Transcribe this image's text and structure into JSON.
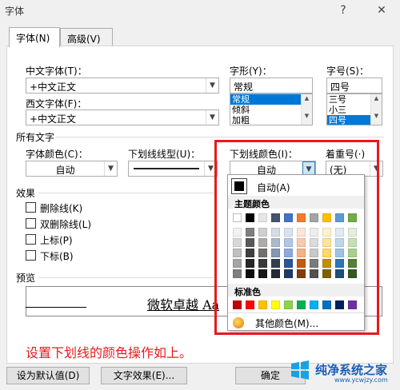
{
  "window": {
    "title": "字体",
    "help": "?",
    "close": "✕"
  },
  "tabs": [
    {
      "label": "字体(N)"
    },
    {
      "label": "高级(V)"
    }
  ],
  "font": {
    "chinese_label": "中文字体(T)：",
    "chinese_value": "+中文正文",
    "western_label": "西文字体(F)：",
    "western_value": "+中文正文",
    "style_label": "字形(Y)：",
    "style_value": "常规",
    "style_options": [
      "常规",
      "倾斜",
      "加粗"
    ],
    "size_label": "字号(S)：",
    "size_value": "四号",
    "size_options": [
      "三号",
      "小三",
      "四号"
    ]
  },
  "all_text": {
    "section_label": "所有文字",
    "font_color_label": "字体颜色(C)：",
    "font_color_value": "自动",
    "underline_style_label": "下划线线型(U)：",
    "underline_color_label": "下划线颜色(I)：",
    "underline_color_value": "自动",
    "emphasis_label": "着重号(·)",
    "emphasis_value": "(无)"
  },
  "effects": {
    "section_label": "效果",
    "items": [
      "删除线(K)",
      "双删除线(L)",
      "上标(P)",
      "下标(B)"
    ]
  },
  "preview": {
    "section_label": "预览",
    "text": "微软卓越 Aa"
  },
  "annotation": "设置下划线的颜色操作如上。",
  "buttons": {
    "default": "设为默认值(D)",
    "text_effects": "文字效果(E)...",
    "ok": "确定"
  },
  "color_popup": {
    "auto_label": "自动(A)",
    "theme_label": "主题颜色",
    "standard_label": "标准色",
    "more_label": "其他颜色(M)...",
    "theme_top": [
      "#FFFFFF",
      "#000000",
      "#E7E6E6",
      "#44546A",
      "#4472C4",
      "#ED7D31",
      "#A5A5A5",
      "#FFC000",
      "#5B9BD5",
      "#70AD47"
    ],
    "theme_shades": [
      [
        "#F2F2F2",
        "#7F7F7F",
        "#D0CECE",
        "#D6DCE4",
        "#D9E2F3",
        "#FBE5D5",
        "#EDEDED",
        "#FFF2CC",
        "#DEEBF6",
        "#E2EFD9"
      ],
      [
        "#D8D8D8",
        "#595959",
        "#AEABAB",
        "#ADB9CA",
        "#B4C6E7",
        "#F7CBAC",
        "#DBDBDB",
        "#FEE599",
        "#BDD7EE",
        "#C5E0B3"
      ],
      [
        "#BFBFBF",
        "#3F3F3F",
        "#757070",
        "#8496B0",
        "#8EAADB",
        "#F4B183",
        "#C9C9C9",
        "#FFD965",
        "#9CC3E5",
        "#A8D08D"
      ],
      [
        "#A5A5A5",
        "#262626",
        "#3A3838",
        "#323F4F",
        "#2F5496",
        "#C55A11",
        "#7B7B7B",
        "#BF9000",
        "#2E75B5",
        "#538135"
      ],
      [
        "#7F7F7F",
        "#0C0C0C",
        "#171616",
        "#222A35",
        "#1F3864",
        "#833C0B",
        "#525252",
        "#7F6000",
        "#1E4E79",
        "#375623"
      ]
    ],
    "standard_colors": [
      "#C00000",
      "#FF0000",
      "#FFC000",
      "#FFFF00",
      "#92D050",
      "#00B050",
      "#00B0F0",
      "#0070C0",
      "#002060",
      "#7030A0"
    ]
  },
  "watermark": {
    "text": "纯净系统之家",
    "url": "www.ycwjzy.com"
  }
}
